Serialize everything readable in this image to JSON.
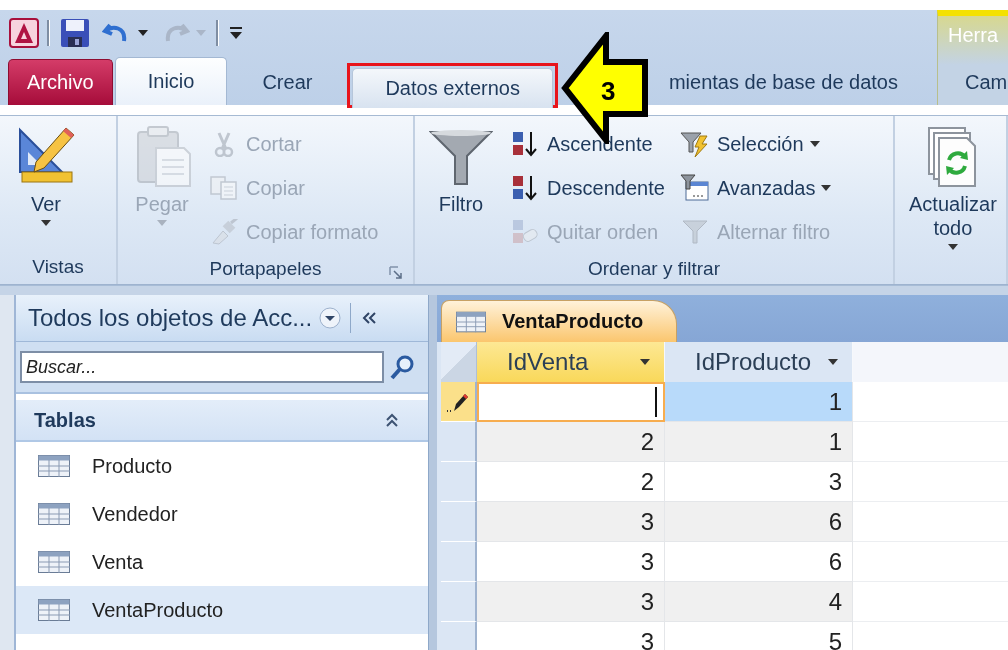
{
  "quick_access": [
    {
      "kind": "app"
    },
    {
      "kind": "save"
    },
    {
      "kind": "undo",
      "disabled": false
    },
    {
      "kind": "redo",
      "disabled": true
    },
    {
      "kind": "customize"
    }
  ],
  "ribbon_tabs": [
    {
      "label": "Archivo",
      "kind": "file",
      "selected": false,
      "highlighted": false
    },
    {
      "label": "Inicio",
      "kind": "tab",
      "selected": true,
      "highlighted": false
    },
    {
      "label": "Crear",
      "kind": "tab",
      "selected": false,
      "highlighted": false
    },
    {
      "label": "Datos externos",
      "kind": "tab",
      "selected": false,
      "highlighted": true
    },
    {
      "label": "mientas de base de datos",
      "kind": "tab",
      "selected": false,
      "highlighted": false
    }
  ],
  "contextual_tabs": {
    "label": "Herra",
    "tabs": [
      {
        "label": "Cam",
        "selected": false
      }
    ]
  },
  "callout": {
    "number": "3"
  },
  "ribbon_groups": [
    {
      "label": "Vistas",
      "commands": [
        {
          "label": "Ver",
          "kind": "large",
          "dropdown": true,
          "disabled": false
        }
      ]
    },
    {
      "label": "Portapapeles",
      "launcher": true,
      "commands": [
        {
          "label": "Pegar",
          "kind": "large",
          "dropdown": true,
          "disabled": true
        },
        {
          "label": "Cortar",
          "kind": "small",
          "disabled": true
        },
        {
          "label": "Copiar",
          "kind": "small",
          "disabled": true
        },
        {
          "label": "Copiar formato",
          "kind": "small",
          "disabled": true
        }
      ]
    },
    {
      "label": "Ordenar y filtrar",
      "commands": [
        {
          "label": "Filtro",
          "kind": "large",
          "disabled": false
        },
        {
          "label": "Ascendente",
          "kind": "small",
          "disabled": false
        },
        {
          "label": "Descendente",
          "kind": "small",
          "disabled": false
        },
        {
          "label": "Quitar orden",
          "kind": "small",
          "disabled": true
        },
        {
          "label": "Selección",
          "kind": "small",
          "dropdown": true,
          "disabled": false
        },
        {
          "label": "Avanzadas",
          "kind": "small",
          "dropdown": true,
          "disabled": false
        },
        {
          "label": "Alternar filtro",
          "kind": "small",
          "disabled": true
        }
      ]
    },
    {
      "commands": [
        {
          "label": "Actualizar todo",
          "kind": "large",
          "dropdown": true,
          "disabled": false
        }
      ]
    }
  ],
  "navigation_pane": {
    "title": "Todos los objetos de Acc...",
    "search": {
      "placeholder": "Buscar..."
    },
    "sections": [
      {
        "label": "Tablas",
        "expanded": true,
        "items": [
          {
            "label": "Producto",
            "selected": false
          },
          {
            "label": "Vendedor",
            "selected": false
          },
          {
            "label": "Venta",
            "selected": false
          },
          {
            "label": "VentaProducto",
            "selected": true
          }
        ]
      }
    ]
  },
  "document_tabs": [
    {
      "label": "VentaProducto",
      "selected": true
    }
  ],
  "datasheet": {
    "columns": [
      {
        "label": "IdVenta",
        "selected": true
      },
      {
        "label": "IdProducto",
        "selected": false
      }
    ],
    "rows": [
      {
        "editing": true,
        "id_producto": "1"
      },
      {
        "editing": false,
        "id_venta": "2",
        "id_producto": "1"
      },
      {
        "editing": false,
        "id_venta": "2",
        "id_producto": "3"
      },
      {
        "editing": false,
        "id_venta": "3",
        "id_producto": "6"
      },
      {
        "editing": false,
        "id_venta": "3",
        "id_producto": "6"
      },
      {
        "editing": false,
        "id_venta": "3",
        "id_producto": "4"
      },
      {
        "editing": false,
        "id_venta": "3",
        "id_producto": "5"
      }
    ]
  }
}
